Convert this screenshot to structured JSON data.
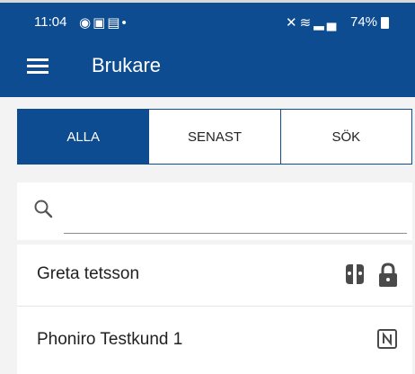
{
  "status_bar": {
    "time": "11:04",
    "battery": "74%"
  },
  "app_bar": {
    "title": "Brukare"
  },
  "tabs": [
    {
      "label": "ALLA",
      "active": true
    },
    {
      "label": "SENAST",
      "active": false
    },
    {
      "label": "SÖK",
      "active": false
    }
  ],
  "search": {
    "value": "",
    "placeholder": ""
  },
  "users": [
    {
      "name": "Greta tetsson",
      "icons": [
        "key-pair-icon",
        "lock-icon"
      ]
    },
    {
      "name": "Phoniro Testkund 1",
      "icons": [
        "nfc-tag-icon"
      ]
    }
  ],
  "colors": {
    "brand": "#0e4c92",
    "background": "#f3f3f3"
  }
}
